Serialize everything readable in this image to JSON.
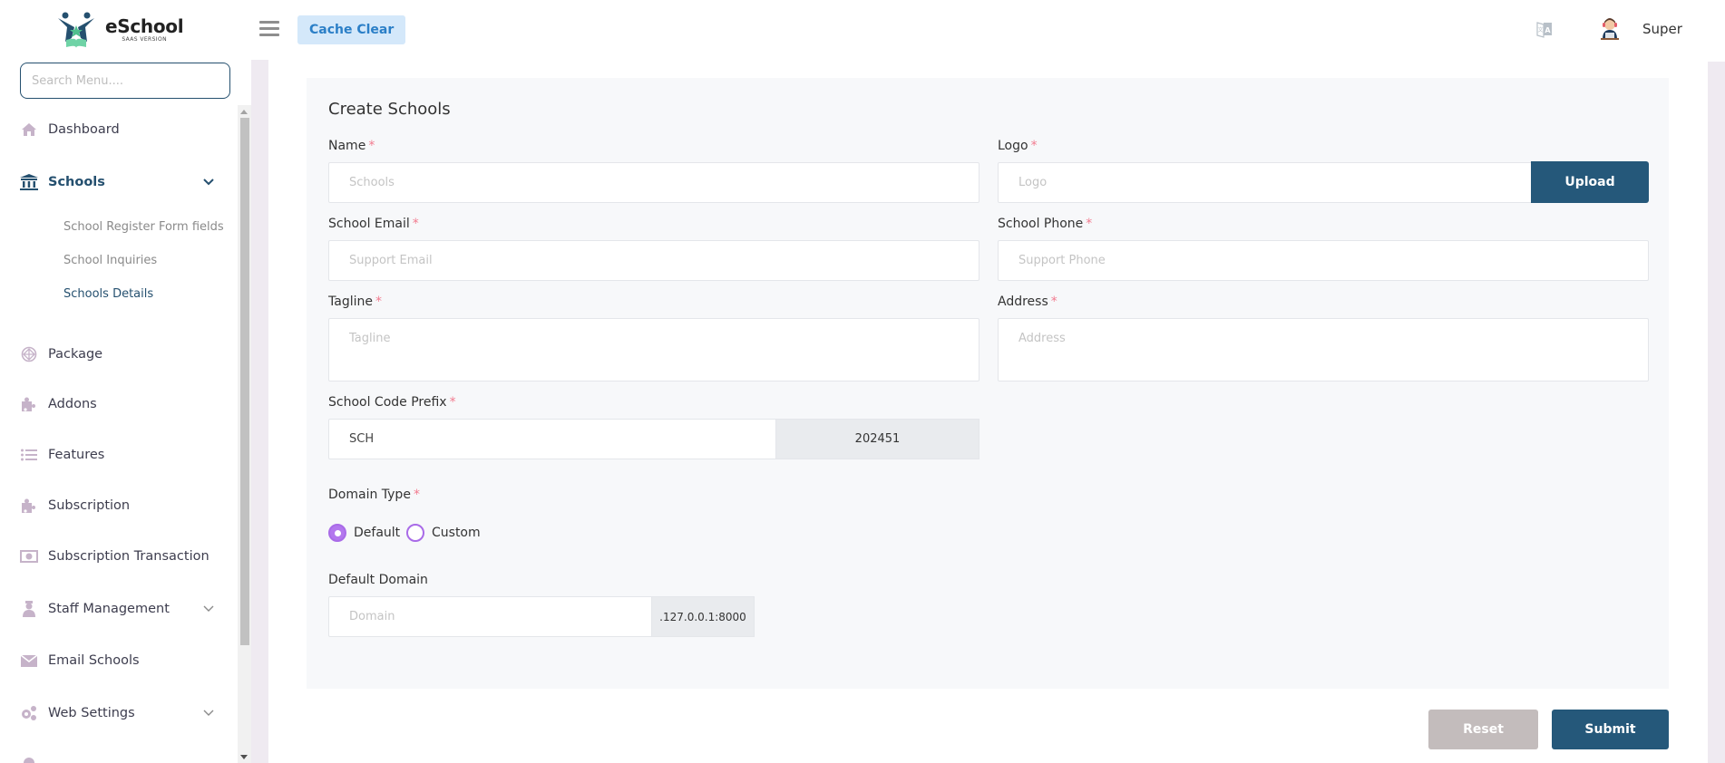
{
  "header": {
    "brand_name": "eSchool",
    "brand_subtitle": "SAAS VERSION",
    "cache_clear_label": "Cache Clear",
    "user_name": "Super"
  },
  "sidebar": {
    "search_placeholder": "Search Menu....",
    "items": [
      {
        "label": "Dashboard",
        "icon": "home-icon"
      },
      {
        "label": "Schools",
        "icon": "bank-icon",
        "active": true,
        "expanded": true,
        "children": [
          {
            "label": "School Register Form fields"
          },
          {
            "label": "School Inquiries"
          },
          {
            "label": "Schools Details",
            "active": true
          }
        ]
      },
      {
        "label": "Package",
        "icon": "package-icon"
      },
      {
        "label": "Addons",
        "icon": "puzzle-icon"
      },
      {
        "label": "Features",
        "icon": "list-icon"
      },
      {
        "label": "Subscription",
        "icon": "puzzle-icon"
      },
      {
        "label": "Subscription Transaction",
        "icon": "money-icon"
      },
      {
        "label": "Staff Management",
        "icon": "staff-icon",
        "has_children": true
      },
      {
        "label": "Email Schools",
        "icon": "envelope-icon"
      },
      {
        "label": "Web Settings",
        "icon": "gears-icon",
        "has_children": true
      }
    ]
  },
  "form": {
    "title": "Create Schools",
    "required_mark": "*",
    "name": {
      "label": "Name",
      "placeholder": "Schools",
      "value": ""
    },
    "logo": {
      "label": "Logo",
      "placeholder": "Logo",
      "button": "Upload"
    },
    "email": {
      "label": "School Email",
      "placeholder": "Support Email",
      "value": ""
    },
    "phone": {
      "label": "School Phone",
      "placeholder": "Support Phone",
      "value": ""
    },
    "tagline": {
      "label": "Tagline",
      "placeholder": "Tagline",
      "value": ""
    },
    "address": {
      "label": "Address",
      "placeholder": "Address",
      "value": ""
    },
    "code_prefix": {
      "label": "School Code Prefix",
      "value": "SCH",
      "suffix": "202451"
    },
    "domain_type": {
      "label": "Domain Type",
      "options": [
        "Default",
        "Custom"
      ],
      "selected": "Default"
    },
    "default_domain": {
      "label": "Default Domain",
      "placeholder": "Domain",
      "suffix": ".127.0.0.1:8000"
    },
    "reset_label": "Reset",
    "submit_label": "Submit"
  },
  "colors": {
    "primary": "#25587a",
    "accent_radio": "#b377ee",
    "required": "#f27b8f",
    "cache_btn_bg": "#d4e8fa"
  }
}
